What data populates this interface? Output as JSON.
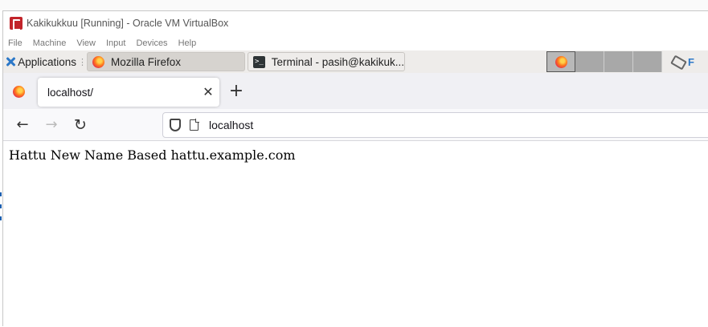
{
  "vbox": {
    "title": "Kakikukkuu [Running] - Oracle VM VirtualBox",
    "menu": [
      "File",
      "Machine",
      "View",
      "Input",
      "Devices",
      "Help"
    ]
  },
  "panel": {
    "applications_label": "Applications",
    "tasks": [
      {
        "label": "Mozilla Firefox",
        "icon": "firefox-icon",
        "active": true
      },
      {
        "label": "Terminal - pasih@kakikuk...",
        "icon": "terminal-icon",
        "active": false
      }
    ],
    "tray_text": "F"
  },
  "firefox": {
    "tab": {
      "title": "localhost/"
    },
    "new_tab_symbol": "+",
    "close_symbol": "✕",
    "url": "localhost"
  },
  "page": {
    "text": "Hattu New Name Based hattu.example.com"
  },
  "colors": {
    "firefox_toolbar": "#f0f0f4",
    "xfce_panel": "#eeecea",
    "xfce_accent": "#2c78c8",
    "vbox_logo": "#c2242a"
  }
}
